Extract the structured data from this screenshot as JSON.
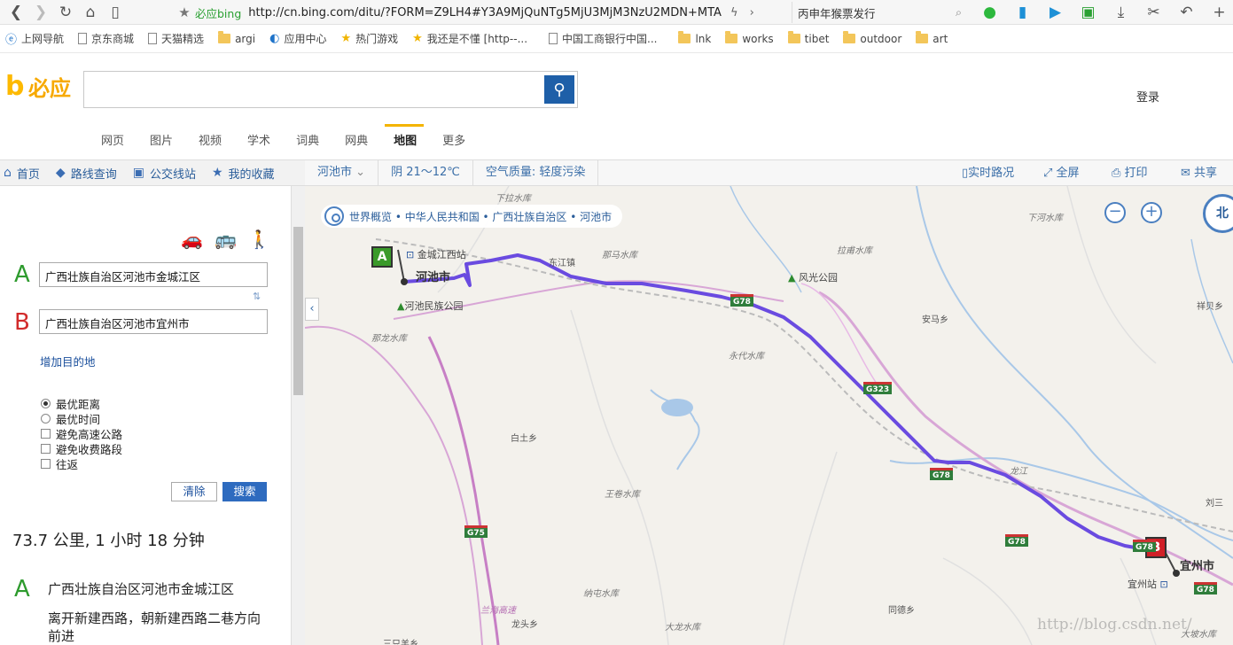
{
  "browser": {
    "site_name": "必应bing",
    "url": "http://cn.bing.com/ditu/?FORM=Z9LH4#Y3A9MjQuNTg5MjU3MjM3NzU2MDN+MTA",
    "hot_search": "丙申年猴票发行"
  },
  "bookmarks": [
    {
      "label": "上网导航",
      "icon": "ie-icon"
    },
    {
      "label": "京东商城",
      "icon": "page-icon"
    },
    {
      "label": "天猫精选",
      "icon": "page-icon"
    },
    {
      "label": "argi",
      "icon": "folder-icon"
    },
    {
      "label": "应用中心",
      "icon": "app-center-icon"
    },
    {
      "label": "热门游戏",
      "icon": "star-icon"
    },
    {
      "label": "我还是不懂 [http--...",
      "icon": "star-icon"
    },
    {
      "label": "中国工商银行中国...",
      "icon": "page-icon"
    },
    {
      "label": "lnk",
      "icon": "folder-icon"
    },
    {
      "label": "works",
      "icon": "folder-icon"
    },
    {
      "label": "tibet",
      "icon": "folder-icon"
    },
    {
      "label": "outdoor",
      "icon": "folder-icon"
    },
    {
      "label": "art",
      "icon": "folder-icon"
    }
  ],
  "bing": {
    "logo_text": "必应",
    "search_value": "",
    "login": "登录",
    "scopes": [
      "网页",
      "图片",
      "视频",
      "学术",
      "词典",
      "网典",
      "地图",
      "更多"
    ],
    "active_scope": "地图"
  },
  "left_nav": {
    "home": "首页",
    "route": "路线查询",
    "transit": "公交线站",
    "favorites": "我的收藏"
  },
  "directions": {
    "from_letter": "A",
    "to_letter": "B",
    "from": "广西壮族自治区河池市金城江区",
    "to": "广西壮族自治区河池市宜州市",
    "add_destination": "增加目的地",
    "options": {
      "best_distance": "最优距离",
      "best_time": "最优时间",
      "avoid_highway": "避免高速公路",
      "avoid_toll": "避免收费路段",
      "round_trip": "往返"
    },
    "selected_option": "最优距离",
    "clear": "清除",
    "search": "搜索",
    "summary": "73.7 公里, 1 小时 18 分钟",
    "step_letter": "A",
    "step_title": "广西壮族自治区河池市金城江区",
    "step_desc": "离开新建西路，朝新建西路二巷方向前进"
  },
  "map_bar": {
    "city": "河池市",
    "weather": "阴 21～12℃",
    "air": "空气质量: 轻度污染",
    "traffic": "实时路况",
    "fullscreen": "全屏",
    "print": "打印",
    "share": "共享"
  },
  "map": {
    "breadcrumb": "世界概览 • 中华人民共和国 • 广西壮族自治区 • 河池市",
    "compass": "北",
    "zoom_out": "−",
    "zoom_in": "+",
    "city_start": "河池市",
    "city_end": "宜州市",
    "pin_a": "A",
    "pin_b": "B",
    "labels": {
      "xiahe": "下拉水库",
      "lagang": "拉甫水库",
      "xiahe2": "下河水库",
      "dongjiang": "东江镇",
      "nama": "那马水库",
      "fengguang": "风光公园",
      "jinchengjiang": "金城江西站",
      "minzu": "河池民族公园",
      "nalong": "那龙水库",
      "yongdai": "永代水库",
      "anma": "安马乡",
      "xiangyi": "祥贝乡",
      "baitu": "白土乡",
      "wangjuan": "王卷水库",
      "nazhi": "纳屯水库",
      "longtou": "龙头乡",
      "dalong": "大龙水库",
      "tongde": "同德乡",
      "yizhou_station": "宜州站",
      "liusan": "刘三",
      "dapo": "大坡水库",
      "sanzhi": "三只羊乡",
      "river": "龙江",
      "g75_road": "兰海高速"
    },
    "shields": [
      "G78",
      "G323",
      "G78",
      "G78",
      "G75",
      "G78",
      "G78"
    ],
    "watermark": "http://blog.csdn.net/"
  }
}
